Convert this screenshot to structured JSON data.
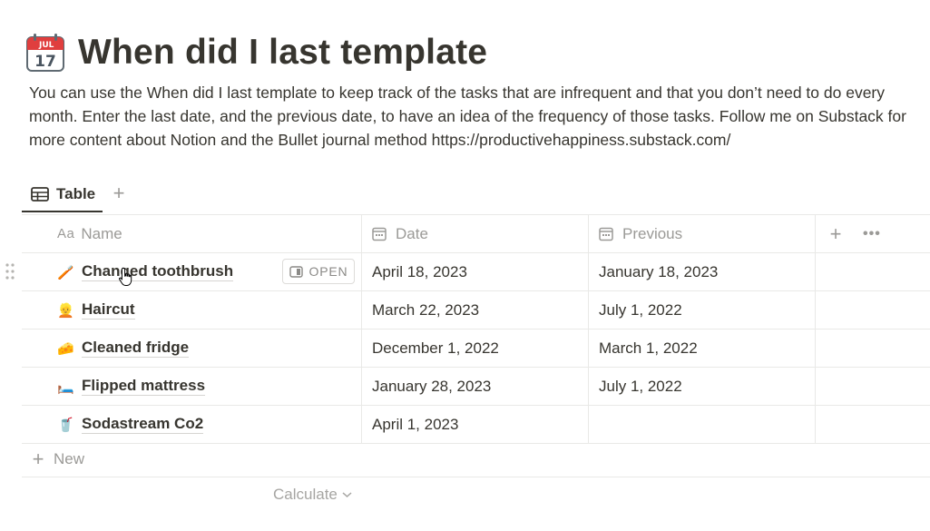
{
  "page": {
    "title": "When did I last template",
    "icon": "calendar-icon",
    "calendar_month": "JUL",
    "calendar_day": "17",
    "description": "You can use the When did I last template to keep track of the tasks that are infrequent and that you don’t need to do every month. Enter the last date, and the previous date, to have an idea of the frequency of those tasks. Follow me on Substack for more content about Notion and the Bullet journal method https://productivehappiness.substack.com/"
  },
  "tabs": [
    {
      "label": "Table",
      "icon": "table-icon",
      "active": true
    }
  ],
  "table": {
    "columns": [
      {
        "label": "Name",
        "icon": "Aa"
      },
      {
        "label": "Date",
        "icon": "calendar-icon"
      },
      {
        "label": "Previous",
        "icon": "calendar-icon"
      }
    ],
    "add_column_symbol": "+",
    "more_symbol": "•••",
    "open_label": "OPEN",
    "rows": [
      {
        "emoji": "🪥",
        "name": "Changed toothbrush",
        "date": "April 18, 2023",
        "previous": "January 18, 2023"
      },
      {
        "emoji": "👱",
        "name": "Haircut",
        "date": "March 22, 2023",
        "previous": "July 1, 2022"
      },
      {
        "emoji": "🧀",
        "name": "Cleaned fridge",
        "date": "December 1, 2022",
        "previous": "March 1, 2022"
      },
      {
        "emoji": "🛏️",
        "name": "Flipped mattress",
        "date": "January 28, 2023",
        "previous": "July 1, 2022"
      },
      {
        "emoji": "🥤",
        "name": "Sodastream Co2",
        "date": "April 1, 2023",
        "previous": ""
      }
    ],
    "new_label": "New",
    "calculate_label": "Calculate"
  },
  "colors": {
    "text": "#37352f",
    "muted": "#9b9a97",
    "border": "#e9e9e7",
    "calendar_red": "#e03e3e"
  }
}
